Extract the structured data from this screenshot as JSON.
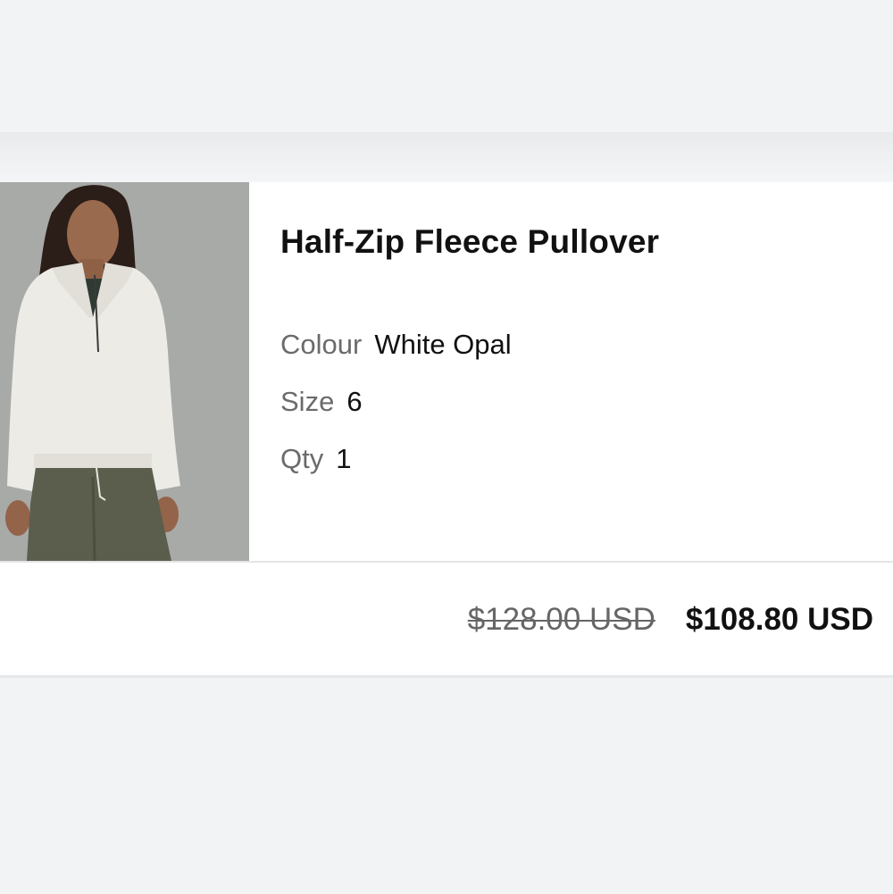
{
  "product": {
    "name": "Half-Zip Fleece Pullover",
    "image_alt": "woman-wearing-white-half-zip-fleece",
    "attributes": {
      "colour_label": "Colour",
      "colour_value": "White Opal",
      "size_label": "Size",
      "size_value": "6",
      "qty_label": "Qty",
      "qty_value": "1"
    },
    "price": {
      "original": "$128.00 USD",
      "sale": "$108.80 USD"
    }
  },
  "colors": {
    "page_background": "#f2f3f5",
    "card_background": "#ffffff",
    "text_primary": "#111111",
    "text_secondary": "#6b6b6b",
    "fleece": "#ecebe6",
    "pants": "#5b5e4c"
  }
}
